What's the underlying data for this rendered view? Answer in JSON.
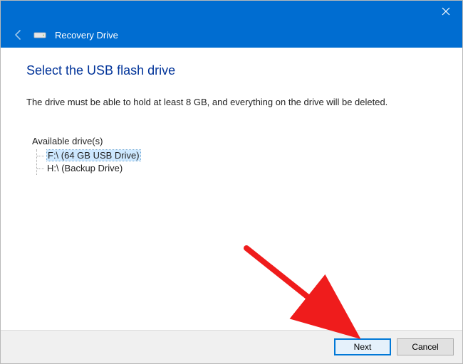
{
  "titlebar": {
    "close_icon": "✕"
  },
  "header": {
    "back_icon": "back-arrow",
    "drive_icon": "drive-icon",
    "app_title": "Recovery Drive"
  },
  "page": {
    "heading": "Select the USB flash drive",
    "instruction": "The drive must be able to hold at least 8 GB, and everything on the drive will be deleted."
  },
  "tree": {
    "root_label": "Available drive(s)",
    "items": [
      {
        "label": "F:\\ (64 GB USB Drive)",
        "selected": true
      },
      {
        "label": "H:\\ (Backup Drive)",
        "selected": false
      }
    ]
  },
  "footer": {
    "next_label": "Next",
    "cancel_label": "Cancel"
  },
  "accent_color": "#006dd1"
}
